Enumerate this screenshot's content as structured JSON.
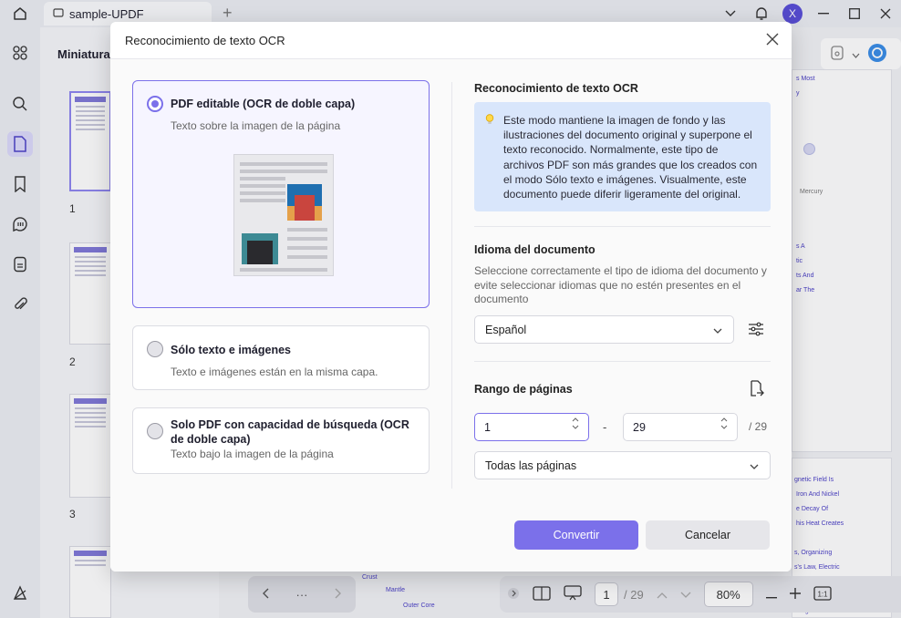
{
  "app": {
    "tab_title": "sample-UPDF",
    "avatar_letter": "X"
  },
  "sidebar": {
    "panel_title": "Miniaturas",
    "thumb_numbers": [
      "1",
      "2",
      "3"
    ]
  },
  "document": {
    "frag_texts": [
      "s Most",
      "y",
      "Mercury",
      "s A",
      "tic",
      "ts And",
      "ar The",
      "gnetic Field Is",
      "Iron And Nickel",
      "e Decay Of",
      "his Heat Creates",
      "s, Organizing",
      "s's Law, Electric",
      "Magnetic Field",
      "Crust",
      "Mantle",
      "Outer Core"
    ]
  },
  "bottom_bar": {
    "more_label": "···",
    "current_page": "1",
    "total_pages": "/ 29",
    "zoom": "80%"
  },
  "dialog": {
    "title": "Reconocimiento de texto OCR",
    "options": [
      {
        "title": "PDF editable (OCR de doble capa)",
        "desc": "Texto sobre la imagen de la página"
      },
      {
        "title": "Sólo texto e imágenes",
        "desc": "Texto e imágenes están en la misma capa."
      },
      {
        "title": "Solo PDF con capacidad de búsqueda (OCR de doble capa)",
        "desc": "Texto bajo la imagen de la página"
      }
    ],
    "info_title": "Reconocimiento de texto OCR",
    "info_text": "Este modo mantiene la imagen de fondo y las ilustraciones del documento original y superpone el texto reconocido. Normalmente, este tipo de archivos PDF son más grandes que los creados con el modo Sólo texto e imágenes. Visualmente, este documento puede diferir ligeramente del original.",
    "lang_title": "Idioma del documento",
    "lang_desc": "Seleccione correctamente el tipo de idioma del documento y evite seleccionar idiomas que no estén presentes en el documento",
    "lang_value": "Español",
    "range_title": "Rango de páginas",
    "range_from": "1",
    "range_to": "29",
    "range_dash": "-",
    "range_total": "/ 29",
    "range_scope": "Todas las páginas",
    "convert_label": "Convertir",
    "cancel_label": "Cancelar"
  },
  "colors": {
    "accent": "#7b70ea",
    "info_bg": "#d9e6fb"
  }
}
